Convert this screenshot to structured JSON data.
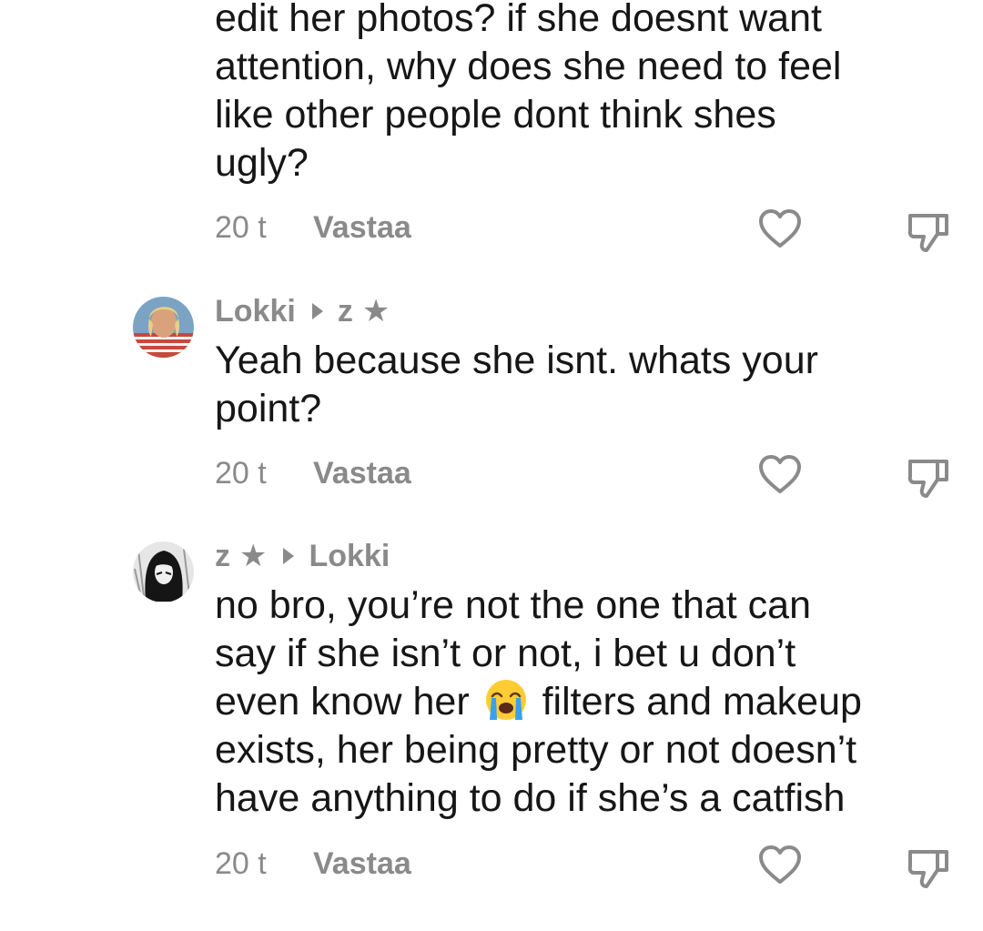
{
  "comments": [
    {
      "text_lines": [
        "edit her photos? if she doesnt want",
        "attention, why does she need to feel",
        "like other people dont think shes",
        "ugly?"
      ],
      "time": "20 t",
      "reply_label": "Vastaa"
    },
    {
      "author": "Lokki",
      "reply_to": "z",
      "reply_to_star": "★",
      "text_lines": [
        "Yeah because she isnt. whats your",
        "point?"
      ],
      "time": "20 t",
      "reply_label": "Vastaa"
    },
    {
      "author": "z",
      "author_star": "★",
      "reply_to": "Lokki",
      "text_lines": [
        "no bro, you’re not the one that can",
        "say if she isn’t or not, i bet u don’t",
        "even know her",
        "filters and makeup",
        "exists, her being pretty or not doesn’t",
        "have anything to do if she’s a catfish"
      ],
      "emoji": "loudly-crying-face",
      "time": "20 t",
      "reply_label": "Vastaa"
    }
  ],
  "colors": {
    "text": "#161616",
    "meta": "#8a8a8a",
    "icon": "#8a8a8a"
  },
  "icons": {
    "like": "heart-outline-icon",
    "dislike": "thumbs-down-outline-icon"
  }
}
